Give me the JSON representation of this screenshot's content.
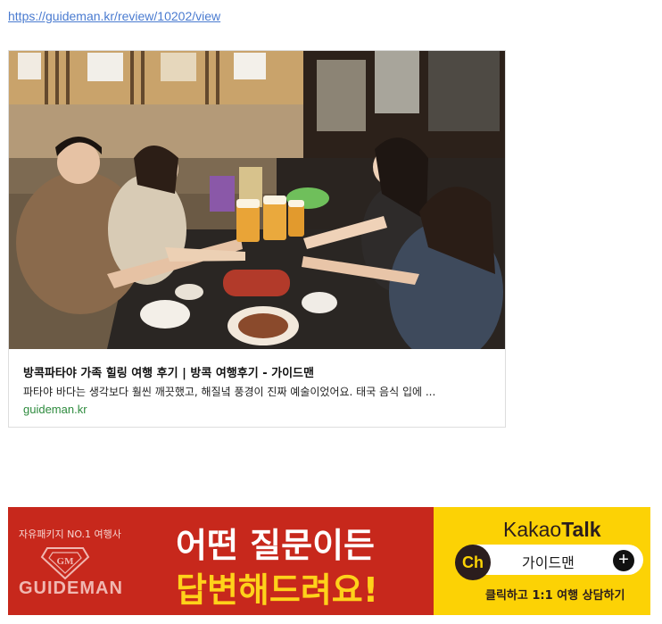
{
  "link": {
    "url_text": "https://guideman.kr/review/10202/view"
  },
  "card": {
    "image_alt": "family toasting with beer at a restaurant",
    "title": "방콕파타야 가족 힐링 여행 후기 | 방콕 여행후기 - 가이드맨",
    "description": "파타야 바다는 생각보다 훨씬 깨끗했고, 해질녘 풍경이 진짜 예술이었어요. 태국 음식 입에 ...",
    "domain": "guideman.kr"
  },
  "banner": {
    "tagline": "자유패키지 NO.1 여행사",
    "logo_text": "GUIDEMAN",
    "headline_line1": "어떤 질문이든",
    "headline_line2": "답변해드려요!",
    "kakao_logo_light": "Kakao",
    "kakao_logo_bold": "Talk",
    "ch_badge": "Ch",
    "channel_name": "가이드맨",
    "plus_symbol": "+",
    "cta": "클릭하고 1:1 여행 상담하기",
    "colors": {
      "left_bg": "#c7281c",
      "right_bg": "#fcd205",
      "headline_accent": "#ffd21a"
    }
  }
}
